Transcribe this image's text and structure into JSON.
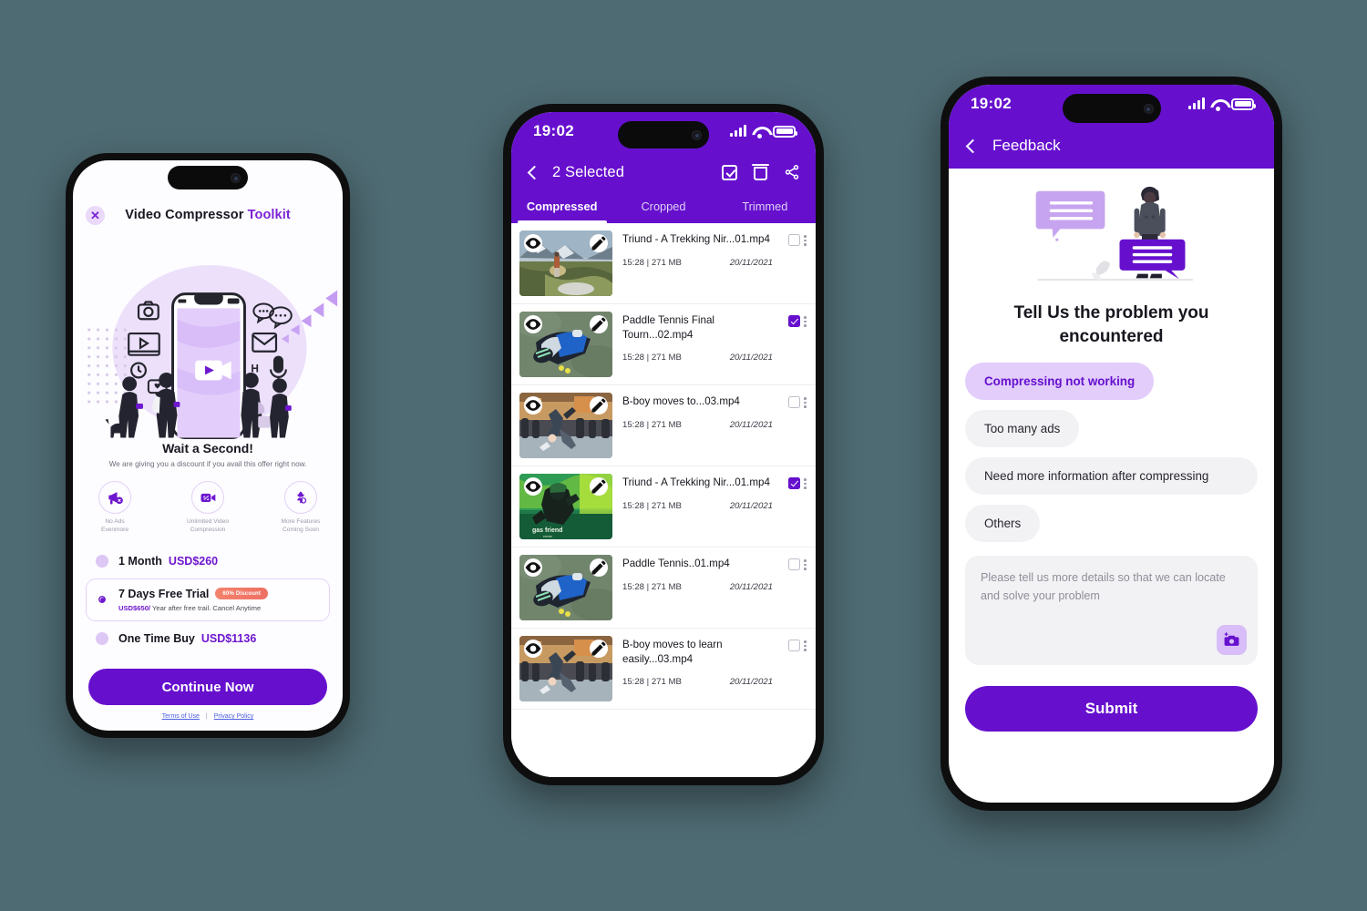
{
  "background_color": "#4e6a72",
  "accent_purple": "#6610ce",
  "phone1": {
    "name": "premium-offer-screen",
    "close_label": "✕",
    "title_plain": "Video Compressor ",
    "title_accent": "Toolkit",
    "heading": "Wait a Second!",
    "subheading": "We are giving you a discount if you avail this offer right now.",
    "features": [
      {
        "icon": "megaphone-off-icon",
        "caption": "No Ads\nEvenmore"
      },
      {
        "icon": "video-compress-icon",
        "caption": "Unlimited Video\nCompression"
      },
      {
        "icon": "more-features-icon",
        "caption": "More Features\nComing Soon"
      }
    ],
    "plans": [
      {
        "name": "1 Month",
        "price": "USD$260",
        "selected": false,
        "badge": "",
        "note": ""
      },
      {
        "name": "7 Days Free Trial",
        "price": "",
        "selected": true,
        "badge": "60% Discount",
        "note_price": "USD$650/",
        "note_rest": " Year after free trail. Cancel Anytime"
      },
      {
        "name": "One  Time Buy",
        "price": "USD$1136",
        "selected": false,
        "badge": "",
        "note": ""
      }
    ],
    "cta_label": "Continue Now",
    "terms_label": "Terms of Use",
    "divider": "|",
    "privacy_label": "Privacy Policy"
  },
  "phone2": {
    "name": "compressed-videos-screen",
    "status_time": "19:02",
    "appbar_title": "2 Selected",
    "actions": [
      "select-all-icon",
      "delete-icon",
      "share-icon"
    ],
    "tabs": [
      {
        "label": "Compressed",
        "active": true
      },
      {
        "label": "Cropped",
        "active": false
      },
      {
        "label": "Trimmed",
        "active": false
      }
    ],
    "videos": [
      {
        "name": "Triund - A Trekking Nir...01.mp4",
        "meta": "15:28 | 271 MB",
        "date": "20/11/2021",
        "checked": false,
        "thumb": "mountain-trek"
      },
      {
        "name": "Paddle Tennis Final Tourn...02.mp4",
        "meta": "15:28 | 271 MB",
        "date": "20/11/2021",
        "checked": true,
        "thumb": "paddle-tennis"
      },
      {
        "name": "B-boy moves to...03.mp4",
        "meta": "15:28 | 271 MB",
        "date": "20/11/2021",
        "checked": false,
        "thumb": "bboy-dance"
      },
      {
        "name": "Triund - A Trekking Nir...01.mp4",
        "meta": "15:28 | 271 MB",
        "date": "20/11/2021",
        "checked": true,
        "thumb": "green-graffiti"
      },
      {
        "name": "Paddle Tennis..01.mp4",
        "meta": "15:28 | 271 MB",
        "date": "20/11/2021",
        "checked": false,
        "thumb": "paddle-tennis"
      },
      {
        "name": "B-boy moves to learn easily...03.mp4",
        "meta": "15:28 | 271 MB",
        "date": "20/11/2021",
        "checked": false,
        "thumb": "bboy-dance"
      }
    ]
  },
  "phone3": {
    "name": "feedback-screen",
    "status_time": "19:02",
    "appbar_title": "Feedback",
    "heading": "Tell Us the problem you encountered",
    "options": [
      {
        "label": "Compressing not working",
        "selected": true,
        "wide": false
      },
      {
        "label": "Too many ads",
        "selected": false,
        "wide": false
      },
      {
        "label": "Need more information after compressing",
        "selected": false,
        "wide": true
      },
      {
        "label": "Others",
        "selected": false,
        "wide": false
      }
    ],
    "textarea_placeholder": "Please tell us more details so that we can locate and solve your problem",
    "attach_icon": "camera-add-icon",
    "submit_label": "Submit"
  }
}
